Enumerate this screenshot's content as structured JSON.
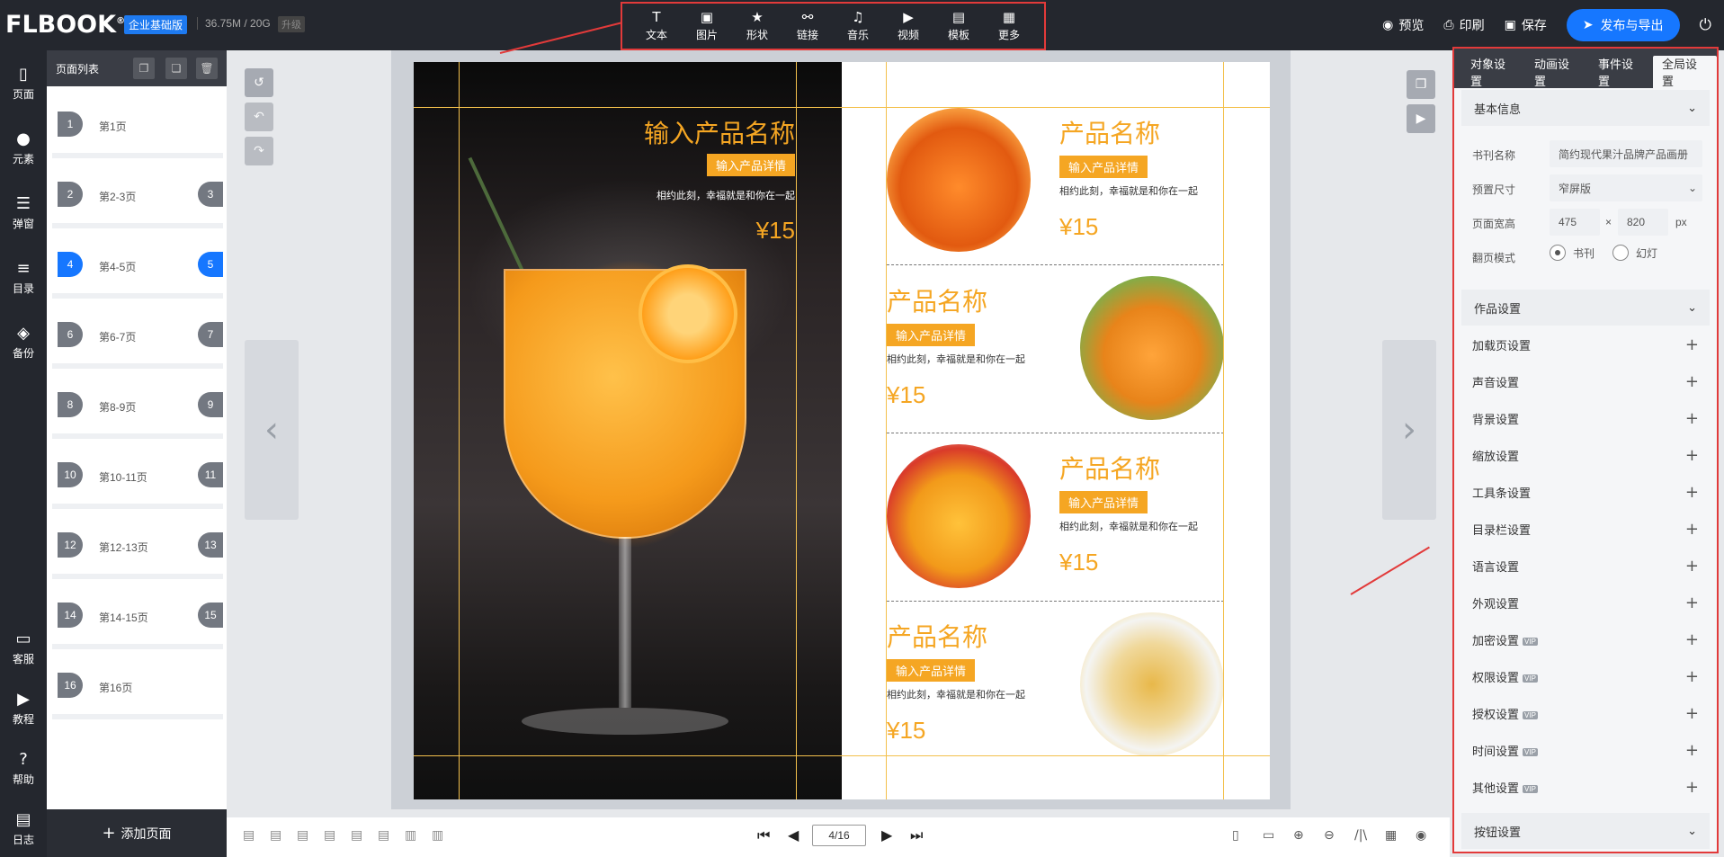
{
  "topbar": {
    "logo": "FLBOOK",
    "edition": "企业基础版",
    "storage": "36.75M / 20G",
    "upgrade": "升级",
    "tools": [
      {
        "icon": "T",
        "label": "文本"
      },
      {
        "icon": "▣",
        "label": "图片"
      },
      {
        "icon": "★",
        "label": "形状"
      },
      {
        "icon": "⚯",
        "label": "链接"
      },
      {
        "icon": "♫",
        "label": "音乐"
      },
      {
        "icon": "▶",
        "label": "视频"
      },
      {
        "icon": "▤",
        "label": "模板"
      },
      {
        "icon": "▦",
        "label": "更多"
      }
    ],
    "preview": "预览",
    "print": "印刷",
    "save": "保存",
    "publish": "发布与导出"
  },
  "leftnav": [
    {
      "icon": "▯",
      "label": "页面"
    },
    {
      "icon": "●",
      "label": "元素"
    },
    {
      "icon": "☰",
      "label": "弹窗"
    },
    {
      "icon": "≡",
      "label": "目录"
    },
    {
      "icon": "◈",
      "label": "备份"
    },
    {
      "icon": "▭",
      "label": "客服"
    },
    {
      "icon": "▶",
      "label": "教程"
    },
    {
      "icon": "?",
      "label": "帮助"
    },
    {
      "icon": "▤",
      "label": "日志"
    }
  ],
  "pages": {
    "title": "页面列表",
    "rows": [
      {
        "n1": "1",
        "n2": "",
        "label": "第1页"
      },
      {
        "n1": "2",
        "n2": "3",
        "label": "第2-3页"
      },
      {
        "n1": "4",
        "n2": "5",
        "label": "第4-5页"
      },
      {
        "n1": "6",
        "n2": "7",
        "label": "第6-7页"
      },
      {
        "n1": "8",
        "n2": "9",
        "label": "第8-9页"
      },
      {
        "n1": "10",
        "n2": "11",
        "label": "第10-11页"
      },
      {
        "n1": "12",
        "n2": "13",
        "label": "第12-13页"
      },
      {
        "n1": "14",
        "n2": "15",
        "label": "第14-15页"
      },
      {
        "n1": "16",
        "n2": "",
        "label": "第16页"
      }
    ],
    "add": "添加页面"
  },
  "left_page": {
    "title": "输入产品名称",
    "tag": "输入产品详情",
    "slogan": "相约此刻，幸福就是和你在一起",
    "price": "¥15"
  },
  "right_page": {
    "items": [
      {
        "title": "产品名称",
        "tag": "输入产品详情",
        "slogan": "相约此刻，幸福就是和你在一起",
        "price": "¥15"
      },
      {
        "title": "产品名称",
        "tag": "输入产品详情",
        "slogan": "相约此刻，幸福就是和你在一起",
        "price": "¥15"
      },
      {
        "title": "产品名称",
        "tag": "输入产品详情",
        "slogan": "相约此刻，幸福就是和你在一起",
        "price": "¥15"
      },
      {
        "title": "产品名称",
        "tag": "输入产品详情",
        "slogan": "相约此刻，幸福就是和你在一起",
        "price": "¥15"
      }
    ]
  },
  "bottombar": {
    "page_indicator": "4/16"
  },
  "rpanel": {
    "tabs": [
      "对象设置",
      "动画设置",
      "事件设置",
      "全局设置"
    ],
    "basic_info": "基本信息",
    "book_name_label": "书刊名称",
    "book_name_value": "简约现代果汁品牌产品画册",
    "size_label": "预置尺寸",
    "size_value": "窄屏版",
    "width_label": "页面宽高",
    "width_value": "475",
    "height_value": "820",
    "times": "×",
    "unit": "px",
    "mode_label": "翻页模式",
    "mode_book": "书刊",
    "mode_slide": "幻灯",
    "work_settings": "作品设置",
    "settings": [
      {
        "label": "加载页设置",
        "vip": ""
      },
      {
        "label": "声音设置",
        "vip": ""
      },
      {
        "label": "背景设置",
        "vip": ""
      },
      {
        "label": "缩放设置",
        "vip": ""
      },
      {
        "label": "工具条设置",
        "vip": ""
      },
      {
        "label": "目录栏设置",
        "vip": ""
      },
      {
        "label": "语言设置",
        "vip": ""
      },
      {
        "label": "外观设置",
        "vip": ""
      },
      {
        "label": "加密设置",
        "vip": "VIP"
      },
      {
        "label": "权限设置",
        "vip": "VIP"
      },
      {
        "label": "授权设置",
        "vip": "VIP"
      },
      {
        "label": "时间设置",
        "vip": "VIP"
      },
      {
        "label": "其他设置",
        "vip": "VIP"
      }
    ],
    "button_settings": "按钮设置"
  }
}
